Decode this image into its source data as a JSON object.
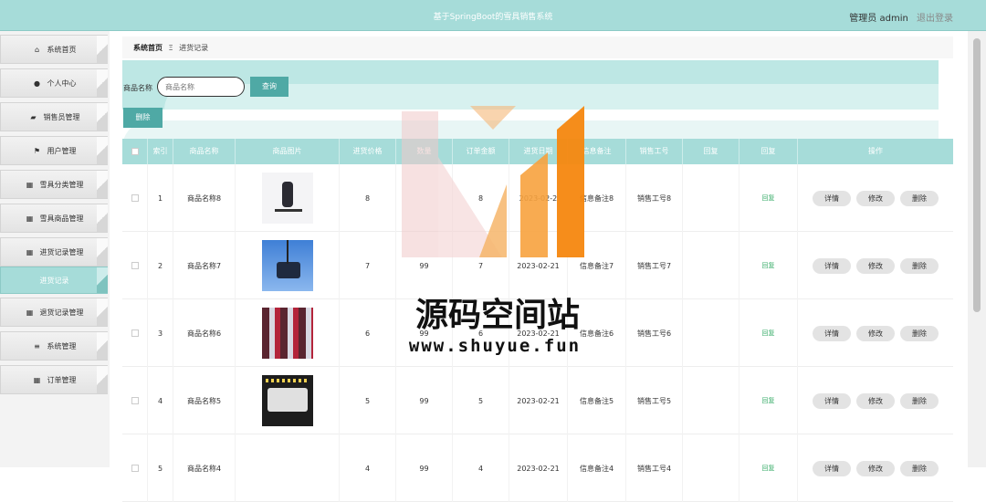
{
  "header": {
    "title": "基于SpringBoot的雪具销售系统",
    "user_label": "管理员 admin",
    "logout_label": "退出登录"
  },
  "sidebar": {
    "items": [
      {
        "label": "系统首页",
        "icon": "home-icon"
      },
      {
        "label": "个人中心",
        "icon": "user-icon"
      },
      {
        "label": "销售员管理",
        "icon": "briefcase-icon"
      },
      {
        "label": "用户管理",
        "icon": "flag-icon"
      },
      {
        "label": "雪具分类管理",
        "icon": "grid-icon"
      },
      {
        "label": "雪具商品管理",
        "icon": "grid-icon"
      },
      {
        "label": "进货记录管理",
        "icon": "grid-icon"
      },
      {
        "label": "进货记录",
        "icon": ""
      },
      {
        "label": "退货记录管理",
        "icon": "grid-icon"
      },
      {
        "label": "系统管理",
        "icon": "menu-icon"
      },
      {
        "label": "订单管理",
        "icon": "grid-icon"
      }
    ]
  },
  "breadcrumb": {
    "home": "系统首页",
    "separator": "Ξ",
    "current": "进货记录"
  },
  "search": {
    "label": "商品名称",
    "placeholder": "商品名称",
    "button": "查询"
  },
  "toolbar": {
    "delete_label": "删除"
  },
  "table": {
    "headers": [
      "索引",
      "商品名称",
      "商品图片",
      "进货价格",
      "数量",
      "订单金额",
      "进货日期",
      "信息备注",
      "销售工号",
      "回复",
      "回复",
      "操作"
    ],
    "rows": [
      {
        "index": "1",
        "name": "商品名称8",
        "price": "8",
        "qty": "",
        "amount": "8",
        "date": "2023-02-2",
        "note": "信息备注8",
        "sales_no": "销售工号8",
        "reply_link": "回复"
      },
      {
        "index": "2",
        "name": "商品名称7",
        "price": "7",
        "qty": "99",
        "amount": "7",
        "date": "2023-02-21",
        "note": "信息备注7",
        "sales_no": "销售工号7",
        "reply_link": "回复"
      },
      {
        "index": "3",
        "name": "商品名称6",
        "price": "6",
        "qty": "99",
        "amount": "6",
        "date": "2023-02-21",
        "note": "信息备注6",
        "sales_no": "销售工号6",
        "reply_link": "回复"
      },
      {
        "index": "4",
        "name": "商品名称5",
        "price": "5",
        "qty": "99",
        "amount": "5",
        "date": "2023-02-21",
        "note": "信息备注5",
        "sales_no": "销售工号5",
        "reply_link": "回复"
      },
      {
        "index": "5",
        "name": "商品名称4",
        "price": "4",
        "qty": "99",
        "amount": "4",
        "date": "2023-02-21",
        "note": "信息备注4",
        "sales_no": "销售工号4",
        "reply_link": "回复"
      }
    ],
    "actions": {
      "detail": "详情",
      "edit": "修改",
      "delete": "删除"
    }
  },
  "watermark": {
    "text": "源码空间站",
    "url": "www.shuyue.fun"
  },
  "colors": {
    "accent": "#a6dcd9",
    "button": "#4fa9a5",
    "reply": "#3cae6c"
  }
}
